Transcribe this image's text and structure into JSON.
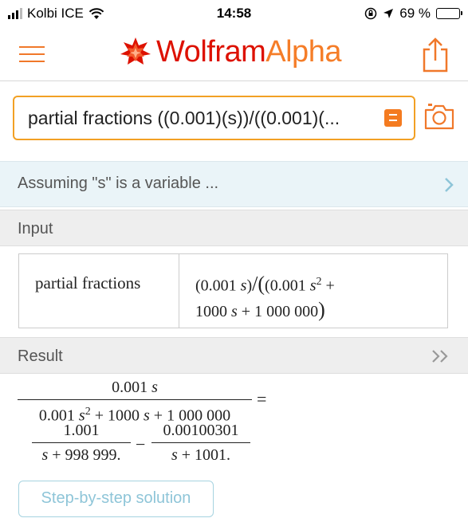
{
  "status_bar": {
    "carrier": "Kolbi ICE",
    "time": "14:58",
    "battery_percent": "69 %",
    "battery_level": 0.69
  },
  "header": {
    "brand_wolfram": "Wolfram",
    "brand_alpha": "Alpha",
    "brand_color": "#dd1100",
    "accent_color": "#f57d28",
    "icons": [
      "menu-icon",
      "wolfram-star-icon",
      "share-icon"
    ]
  },
  "search": {
    "query": "partial fractions ((0.001)(s))/((0.001)(..."
  },
  "assumption": {
    "text": "Assuming \"s\" is a variable ..."
  },
  "input_pod": {
    "title": "Input",
    "label": "partial fractions",
    "expr_line1_a": "(0.001 ",
    "expr_s1": "s",
    "expr_line1_b": ")",
    "expr_slash": "/",
    "expr_line1_c": "(0.001 ",
    "expr_s2": "s",
    "expr_exp": "2",
    "expr_line1_d": " +",
    "expr_line2_a": "1000 ",
    "expr_s3": "s",
    "expr_line2_b": " + 1 000 000",
    "expr_close": ")"
  },
  "result_pod": {
    "title": "Result",
    "lhs_num_coef": "0.001 ",
    "lhs_num_var": "s",
    "lhs_den_a": "0.001 ",
    "lhs_den_s1": "s",
    "lhs_den_exp": "2",
    "lhs_den_b": " + 1000 ",
    "lhs_den_s2": "s",
    "lhs_den_c": " + 1 000 000",
    "equals": "=",
    "term1_num": "1.001",
    "term1_den_var": "s",
    "term1_den_rest": " + 998 999.",
    "minus": "−",
    "term2_num": "0.00100301",
    "term2_den_var": "s",
    "term2_den_rest": " + 1001."
  },
  "step_button": {
    "label": "Step-by-step solution"
  }
}
